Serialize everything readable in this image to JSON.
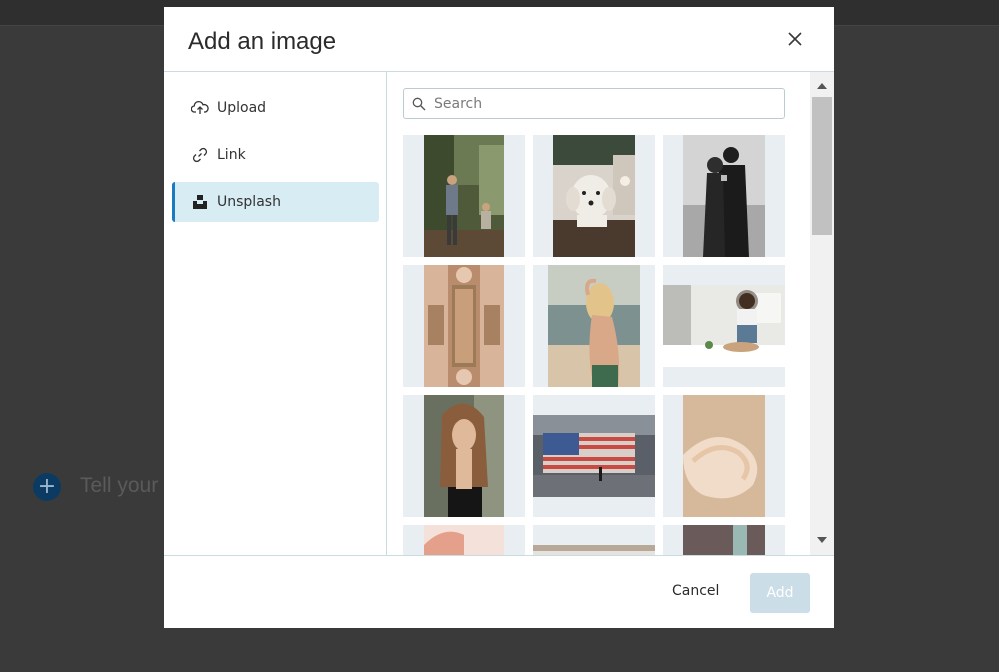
{
  "background": {
    "placeholder": "Tell your s",
    "add_icon": "plus-icon"
  },
  "dialog": {
    "title": "Add an image",
    "close_icon": "close-icon"
  },
  "sidebar": {
    "items": [
      {
        "label": "Upload",
        "icon": "upload-icon"
      },
      {
        "label": "Link",
        "icon": "link-icon"
      },
      {
        "label": "Unsplash",
        "icon": "unsplash-icon",
        "active": true
      }
    ]
  },
  "search": {
    "placeholder": "Search",
    "value": "",
    "icon": "search-icon"
  },
  "images": [
    {
      "subject": "hikers-in-forest"
    },
    {
      "subject": "white-dog-on-bench"
    },
    {
      "subject": "couple-embracing-bw"
    },
    {
      "subject": "ornate-ceiling"
    },
    {
      "subject": "woman-at-beach"
    },
    {
      "subject": "woman-in-kitchen"
    },
    {
      "subject": "woman-long-hair-portrait"
    },
    {
      "subject": "american-flag-billboard"
    },
    {
      "subject": "peach-swirl-abstract"
    },
    {
      "subject": "partial-image-1"
    },
    {
      "subject": "partial-image-2"
    },
    {
      "subject": "partial-image-3"
    }
  ],
  "footer": {
    "cancel_label": "Cancel",
    "add_label": "Add"
  },
  "colors": {
    "accent": "#1a7bc0",
    "active_bg": "#d8ecf4",
    "add_disabled": "#cbdde6"
  }
}
